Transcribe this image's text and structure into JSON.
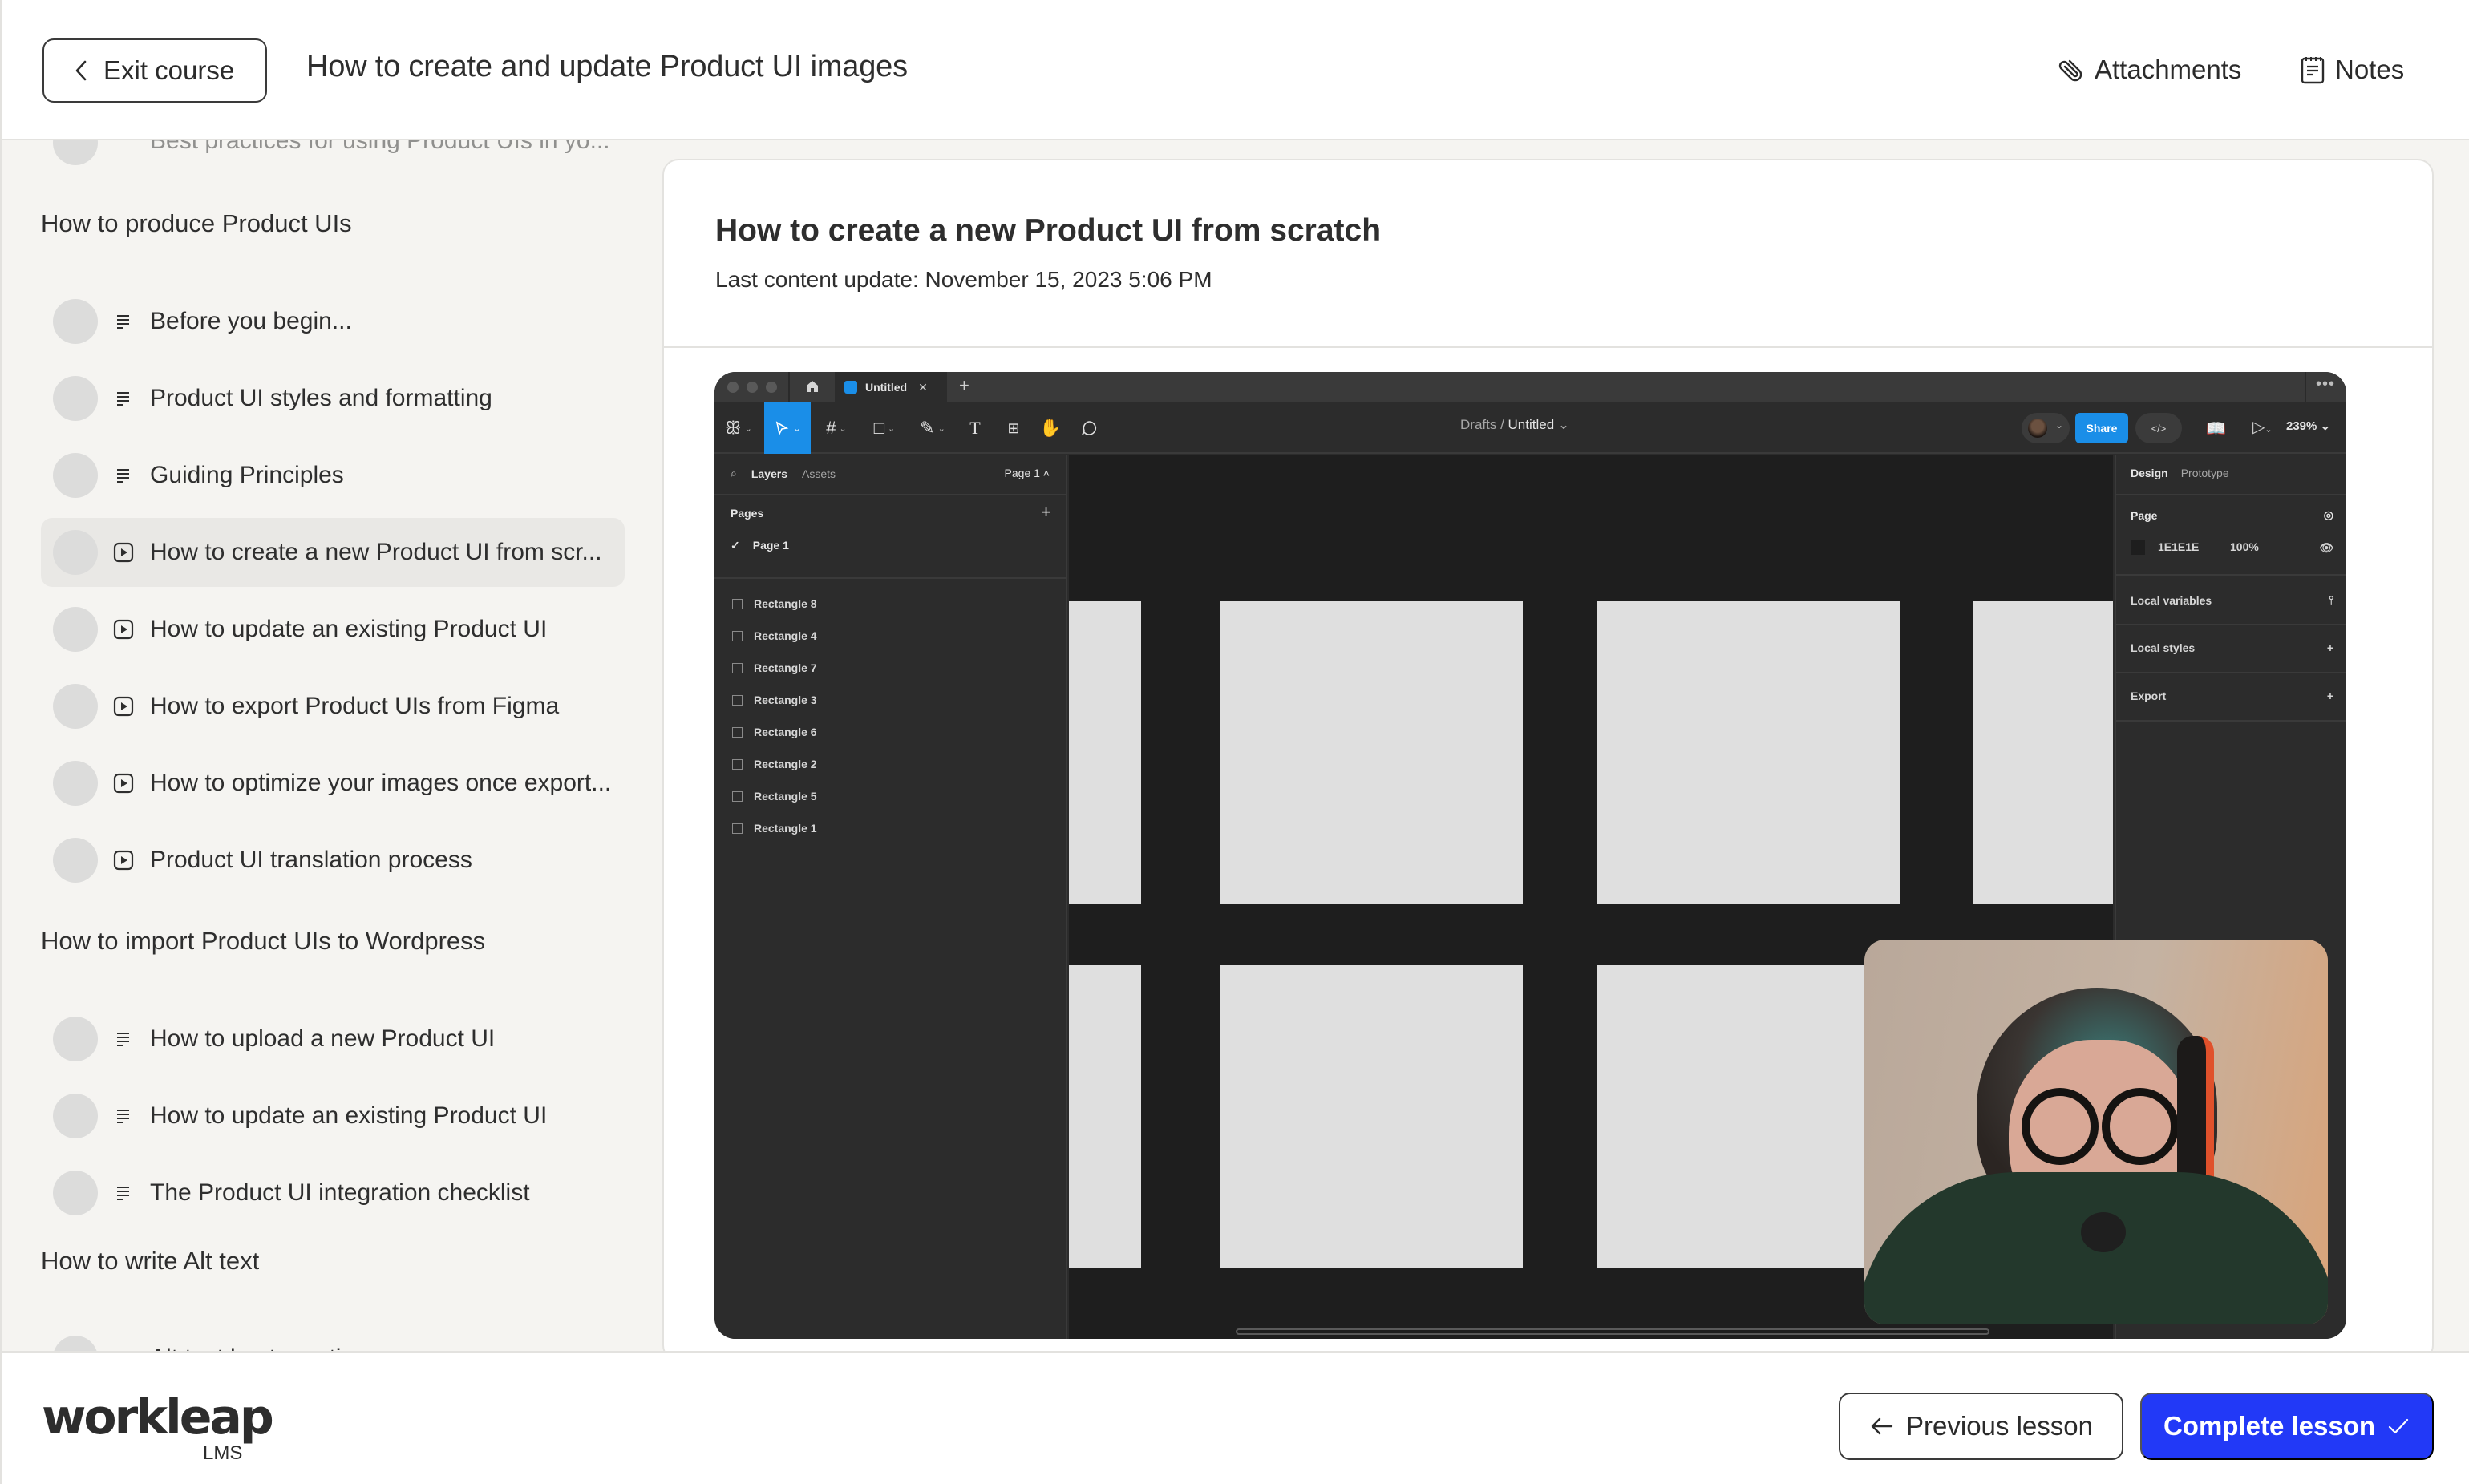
{
  "header": {
    "exit_label": "Exit course",
    "course_title": "How to create and update Product UI images",
    "attachments_label": "Attachments",
    "notes_label": "Notes"
  },
  "sidebar": {
    "truncated_item": "Best practices for using Product UIs in yo...",
    "sections": [
      {
        "title": "How to produce Product UIs",
        "lessons": [
          {
            "label": "Before you begin...",
            "type": "article-icon",
            "active": false
          },
          {
            "label": "Product UI styles and formatting",
            "type": "article-icon",
            "active": false
          },
          {
            "label": "Guiding Principles",
            "type": "article-icon",
            "active": false
          },
          {
            "label": "How to create a new Product UI from scr...",
            "type": "video-icon",
            "active": true
          },
          {
            "label": "How to update an existing Product UI",
            "type": "video-icon",
            "active": false
          },
          {
            "label": "How to export Product UIs from Figma",
            "type": "video-icon",
            "active": false
          },
          {
            "label": "How to optimize your images once export...",
            "type": "video-icon",
            "active": false
          },
          {
            "label": "Product UI translation process",
            "type": "video-icon",
            "active": false
          }
        ]
      },
      {
        "title": "How to import Product UIs to Wordpress",
        "lessons": [
          {
            "label": "How to upload a new Product UI",
            "type": "article-icon",
            "active": false
          },
          {
            "label": "How to update an existing Product UI",
            "type": "article-icon",
            "active": false
          },
          {
            "label": "The Product UI integration checklist",
            "type": "article-icon",
            "active": false
          }
        ]
      },
      {
        "title": "How to write Alt text",
        "lessons": [
          {
            "label": "Alt text best practices",
            "type": "article-icon",
            "active": false
          }
        ]
      }
    ]
  },
  "lesson": {
    "title": "How to create a new Product UI from scratch",
    "last_update": "Last content update: November 15, 2023 5:06 PM"
  },
  "video": {
    "figma": {
      "tab_title": "Untitled",
      "breadcrumb_parent": "Drafts",
      "breadcrumb_file": "Untitled",
      "share_label": "Share",
      "zoom_level": "239%",
      "left_tabs": [
        "Layers",
        "Assets"
      ],
      "page_selector": "Page 1",
      "pages_title": "Pages",
      "current_page": "Page 1",
      "layers": [
        "Rectangle 8",
        "Rectangle 4",
        "Rectangle 7",
        "Rectangle 3",
        "Rectangle 6",
        "Rectangle 2",
        "Rectangle 5",
        "Rectangle 1"
      ],
      "right_tabs": [
        "Design",
        "Prototype"
      ],
      "page_section": "Page",
      "page_color": "1E1E1E",
      "page_opacity": "100%",
      "local_variables": "Local variables",
      "local_styles": "Local styles",
      "export": "Export"
    }
  },
  "footer": {
    "logo": "workleap",
    "logo_sub": "LMS",
    "previous_label": "Previous lesson",
    "complete_label": "Complete lesson"
  },
  "colors": {
    "primary": "#2239f7",
    "sidebar_bg": "#f5f4f1",
    "active_item_bg": "#e9e8e5",
    "figma_blue": "#1a8ee8"
  }
}
